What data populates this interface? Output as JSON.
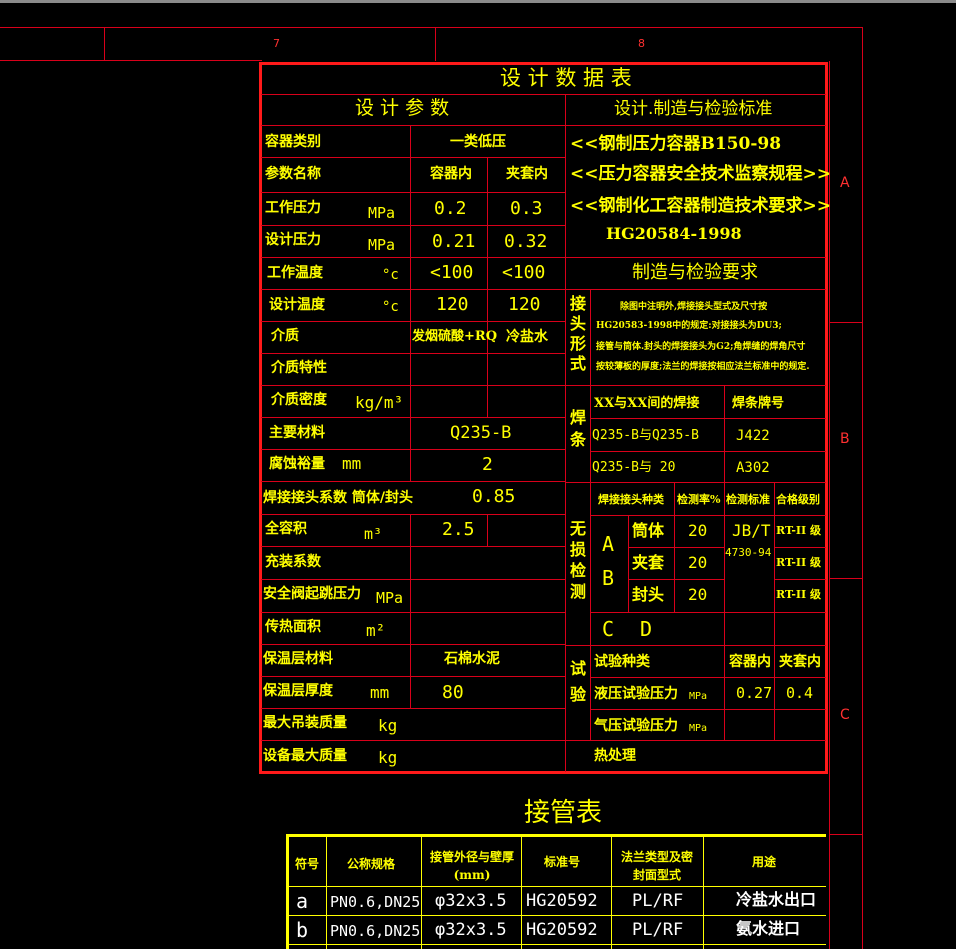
{
  "frame": {
    "col7": "7",
    "col8": "8",
    "rowA": "A",
    "rowB": "B",
    "rowC": "C"
  },
  "colors": {
    "background": "#000000",
    "grid_red": "#d8001a",
    "border_red": "#ff1a1a",
    "text_yellow": "#ffff00",
    "text_white": "#ffffff"
  },
  "design_table": {
    "title": "设 计 数 据 表",
    "left_header": "设 计 参 数",
    "right_header": "设计.制造与检验标准",
    "rows": {
      "container_class_label": "容器类别",
      "container_class_value": "一类低压",
      "param_name_label": "参数名称",
      "col_vessel": "容器内",
      "col_jacket": "夹套内",
      "work_pressure_label": "工作压力",
      "unit_mpa": "MPa",
      "work_pressure_vessel": "0.2",
      "work_pressure_jacket": "0.3",
      "design_pressure_label": "设计压力",
      "design_pressure_vessel": "0.21",
      "design_pressure_jacket": "0.32",
      "work_temp_label": "工作温度",
      "unit_c": "°c",
      "work_temp_vessel": "<100",
      "work_temp_jacket": "<100",
      "design_temp_label": "设计温度",
      "design_temp_vessel": "120",
      "design_temp_jacket": "120",
      "medium_label": "介质",
      "medium_vessel": "发烟硫酸+RQ",
      "medium_jacket": "冷盐水",
      "medium_property_label": "介质特性",
      "medium_density_label": "介质密度",
      "unit_density": "kg/m³",
      "main_material_label": "主要材料",
      "main_material_value": "Q235-B",
      "corrosion_label": "腐蚀裕量",
      "unit_mm": "mm",
      "corrosion_value": "2",
      "weld_coeff_label": "焊接接头系数  筒体/封头",
      "weld_coeff_value": "0.85",
      "volume_label": "全容积",
      "unit_m3": "m³",
      "volume_value": "2.5",
      "fill_label": "充装系数",
      "safety_valve_label": "安全阀起跳压力",
      "heat_area_label": "传热面积",
      "unit_m2": "m²",
      "insul_material_label": "保温层材料",
      "insul_material_value": "石棉水泥",
      "insul_thick_label": "保温层厚度",
      "insul_thick_value": "80",
      "max_lift_label": "最大吊装质量",
      "unit_kg": "kg",
      "max_mass_label": "设备最大质量"
    },
    "standards": {
      "s1": "<<钢制压力容器B150-98",
      "s2": "<<压力容器安全技术监察规程>>",
      "s3": "<<钢制化工容器制造技术要求>>",
      "s4": "HG20584-1998",
      "mfg_header": "制造与检验要求"
    },
    "joint": {
      "label": "接头形式",
      "text1": "除图中注明外,焊接接头型式及尺寸按",
      "text2": "HG20583-1998中的规定:对接接头为DU3;",
      "text3": "接管与筒体.封头的焊接接头为G2;角焊缝的焊角尺寸",
      "text4": "按较薄板的厚度;法兰的焊接按相应法兰标准中的规定."
    },
    "weld": {
      "label": "焊条",
      "h1": "XX与XX间的焊接",
      "h2": "焊条牌号",
      "r1a": "Q235-B与Q235-B",
      "r1b": "J422",
      "r2a": "Q235-B与 20",
      "r2b": "A302"
    },
    "ndt": {
      "label": "无损检测",
      "h1": "焊接接头种类",
      "h2": "检测率%",
      "h3": "检测标准",
      "h4": "合格级别",
      "a": "A",
      "b": "B",
      "c": "C",
      "d": "D",
      "row1": "筒体",
      "row2": "夹套",
      "row3": "封头",
      "rate": "20",
      "std1": "JB/T",
      "std2": "4730-94",
      "grade": "RT-II 级"
    },
    "test": {
      "label": "试验",
      "h1": "试验种类",
      "h2": "容器内",
      "h3": "夹套内",
      "hydro_label": "液压试验压力",
      "hydro_vessel": "0.27",
      "hydro_jacket": "0.4",
      "gas_label": "气压试验压力",
      "heat_treat": "热处理"
    }
  },
  "nozzle_table": {
    "title": "接管表",
    "headers": [
      "符号",
      "公称规格",
      "接管外径与壁厚(mm)",
      "标准号",
      "法兰类型及密封面型式",
      "用途"
    ],
    "rows": [
      [
        "a",
        "PN0.6,DN25",
        "φ32x3.5",
        "HG20592",
        "PL/RF",
        "冷盐水出口"
      ],
      [
        "b",
        "PN0.6,DN25",
        "φ32x3.5",
        "HG20592",
        "PL/RF",
        "氨水进口"
      ]
    ]
  }
}
